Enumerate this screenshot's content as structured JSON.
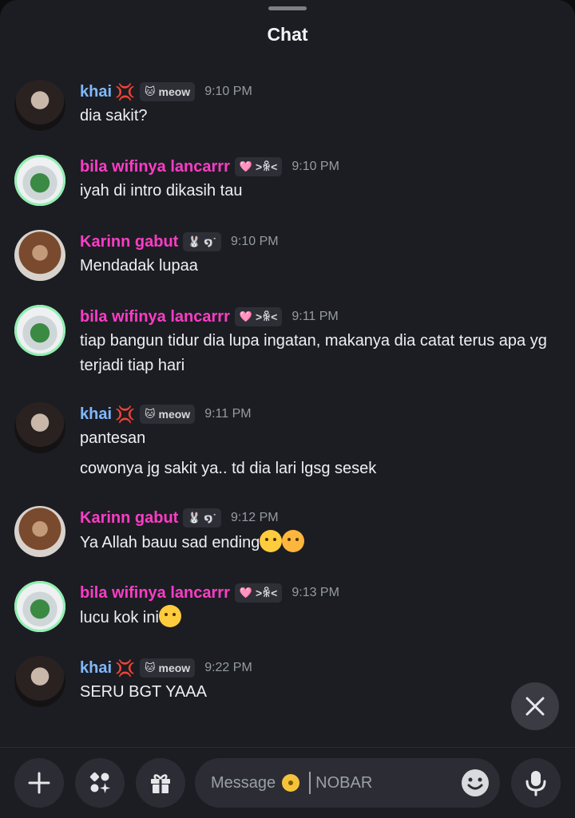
{
  "header": {
    "title": "Chat"
  },
  "messages": [
    {
      "name": "khai",
      "tag_icon": "🐱",
      "tag": "meow",
      "time": "9:10 PM",
      "lines": [
        "dia sakit?"
      ]
    },
    {
      "name": "bila wifinya lancarrr",
      "tag_icon": "🩷",
      "tag": ">ꆜ<",
      "time": "9:10 PM",
      "lines": [
        "iyah di intro dikasih tau"
      ]
    },
    {
      "name": "Karinn gabut",
      "tag_icon": "🐰",
      "tag": "໑˙",
      "time": "9:10 PM",
      "lines": [
        "Mendadak lupaa"
      ]
    },
    {
      "name": "bila wifinya lancarrr",
      "tag_icon": "🩷",
      "tag": ">ꆜ<",
      "time": "9:11 PM",
      "lines": [
        "tiap bangun tidur dia lupa ingatan, makanya dia catat terus apa yg terjadi tiap hari"
      ]
    },
    {
      "name": "khai",
      "tag_icon": "🐱",
      "tag": "meow",
      "time": "9:11 PM",
      "lines": [
        "pantesan",
        "cowonya jg sakit ya.. td dia lari lgsg sesek"
      ]
    },
    {
      "name": "Karinn gabut",
      "tag_icon": "🐰",
      "tag": "໑˙",
      "time": "9:12 PM",
      "lines": [
        "Ya Allah bauu sad ending"
      ]
    },
    {
      "name": "bila wifinya lancarrr",
      "tag_icon": "🩷",
      "tag": ">ꆜ<",
      "time": "9:13 PM",
      "lines": [
        "lucu kok ini"
      ]
    },
    {
      "name": "khai",
      "tag_icon": "🐱",
      "tag": "meow",
      "time": "9:22 PM",
      "lines": [
        "SERU BGT YAAA"
      ]
    }
  ],
  "composer": {
    "placeholder": "Message",
    "channel": "NOBAR"
  },
  "icons": {
    "close": "close-icon",
    "plus": "plus-icon",
    "apps": "apps-icon",
    "gift": "gift-icon",
    "emoji": "emoji-icon",
    "mic": "microphone-icon",
    "name_deco": "anger-icon"
  },
  "colors": {
    "background": "#1c1d22",
    "name_blue": "#7fb8ff",
    "name_pink": "#ff3cc7",
    "timestamp": "#949ba4"
  }
}
